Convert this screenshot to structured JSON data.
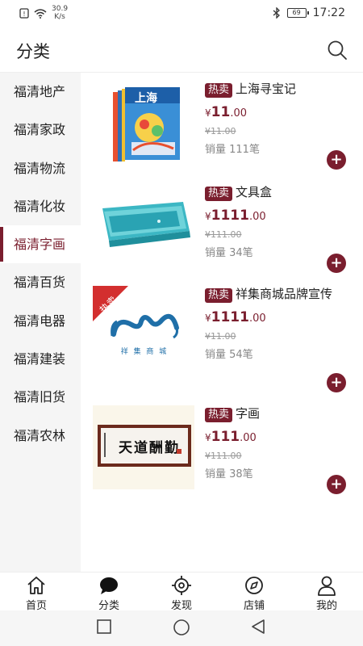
{
  "status_bar": {
    "net_speed_value": "30.9",
    "net_speed_unit": "K/s",
    "battery": "69",
    "time": "17:22"
  },
  "header": {
    "title": "分类",
    "search_icon": "search-icon"
  },
  "sidebar": {
    "items": [
      {
        "label": "福清地产"
      },
      {
        "label": "福清家政"
      },
      {
        "label": "福清物流"
      },
      {
        "label": "福清化妆"
      },
      {
        "label": "福清字画",
        "active": true
      },
      {
        "label": "福清百货"
      },
      {
        "label": "福清电器"
      },
      {
        "label": "福清建装"
      },
      {
        "label": "福清旧货"
      },
      {
        "label": "福清农林"
      }
    ]
  },
  "products": [
    {
      "tag": "热卖",
      "name": "上海寻宝记",
      "price_symbol": "¥",
      "price_int": "11",
      "price_dec": ".00",
      "old_price": "¥11.00",
      "sales": "销量 111笔",
      "image": "book-set"
    },
    {
      "tag": "热卖",
      "name": "文具盒",
      "price_symbol": "¥",
      "price_int": "1111",
      "price_dec": ".00",
      "old_price": "¥111.00",
      "sales": "销量 34笔",
      "image": "pencil-case"
    },
    {
      "tag": "热卖",
      "name": "祥集商城品牌宣传",
      "price_symbol": "¥",
      "price_int": "1111",
      "price_dec": ".00",
      "old_price": "¥11.00",
      "sales": "销量 54笔",
      "image": "brand-logo",
      "image_ribbon": "热卖",
      "image_caption": "祥 集 商 城"
    },
    {
      "tag": "热卖",
      "name": "字画",
      "price_symbol": "¥",
      "price_int": "111",
      "price_dec": ".00",
      "old_price": "¥111.00",
      "sales": "销量 38笔",
      "image": "calligraphy",
      "image_text": "天道酬勤"
    }
  ],
  "bottom_nav": [
    {
      "label": "首页",
      "icon": "home-icon"
    },
    {
      "label": "分类",
      "icon": "chat-bubble-icon"
    },
    {
      "label": "发现",
      "icon": "target-icon"
    },
    {
      "label": "店铺",
      "icon": "compass-icon"
    },
    {
      "label": "我的",
      "icon": "person-icon"
    }
  ],
  "colors": {
    "accent": "#7a1e2e",
    "sidebar_bg": "#f5f5f5",
    "muted_text": "#888888"
  }
}
